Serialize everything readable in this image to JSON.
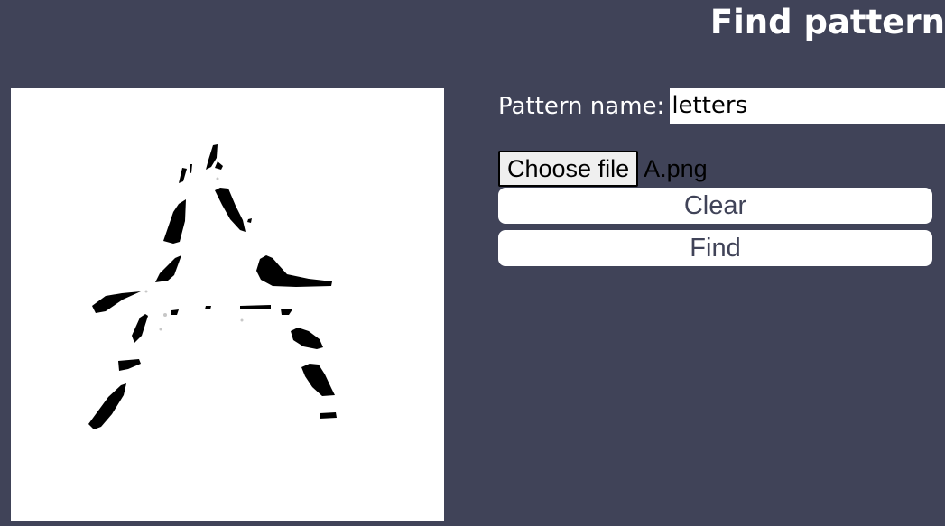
{
  "header": {
    "title": "Find pattern"
  },
  "form": {
    "pattern_name_label": "Pattern name:",
    "pattern_name_value": "letters",
    "choose_file_label": "Choose file",
    "file_name": "A.png",
    "clear_label": "Clear",
    "find_label": "Find"
  },
  "colors": {
    "background": "#404358",
    "canvas": "#ffffff",
    "strokes": "#000000",
    "button_text": "#404358"
  }
}
